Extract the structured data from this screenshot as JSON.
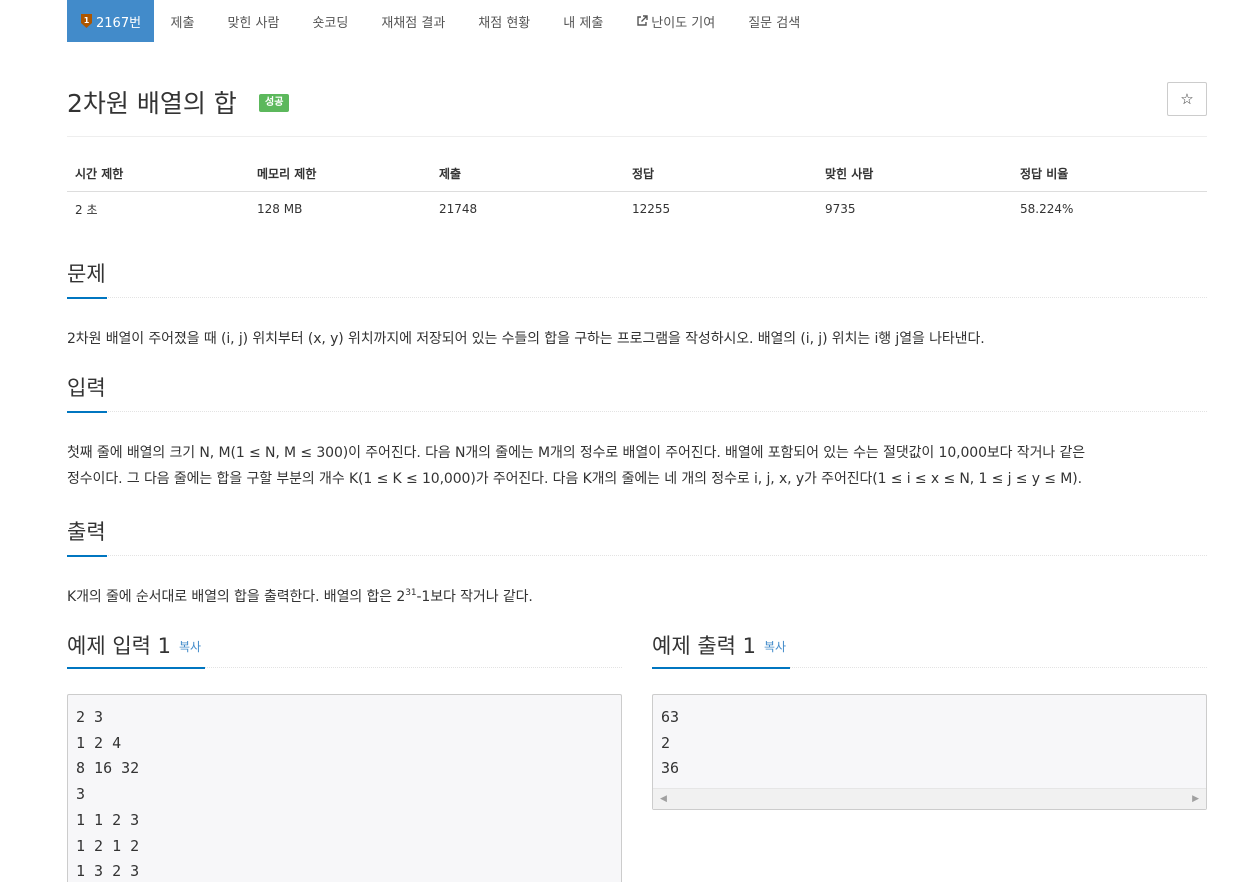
{
  "nav": {
    "tabs": [
      {
        "label": "2167번",
        "active": true
      },
      {
        "label": "제출"
      },
      {
        "label": "맞힌 사람"
      },
      {
        "label": "숏코딩"
      },
      {
        "label": "재채점 결과"
      },
      {
        "label": "채점 현황"
      },
      {
        "label": "내 제출"
      },
      {
        "label": "난이도 기여"
      },
      {
        "label": "질문 검색"
      }
    ]
  },
  "problem": {
    "title": "2차원 배열의 합",
    "status_badge": "성공",
    "star_symbol": "☆"
  },
  "info": {
    "headers": [
      "시간 제한",
      "메모리 제한",
      "제출",
      "정답",
      "맞힌 사람",
      "정답 비율"
    ],
    "values": [
      "2 초",
      "128 MB",
      "21748",
      "12255",
      "9735",
      "58.224%"
    ]
  },
  "sections": {
    "description": {
      "heading": "문제",
      "text": "2차원 배열이 주어졌을 때 (i, j) 위치부터 (x, y) 위치까지에 저장되어 있는 수들의 합을 구하는 프로그램을 작성하시오. 배열의 (i, j) 위치는 i행 j열을 나타낸다."
    },
    "input": {
      "heading": "입력",
      "line1": "첫째 줄에 배열의 크기 N, M(1 ≤ N, M ≤ 300)이 주어진다. 다음 N개의 줄에는 M개의 정수로 배열이 주어진다. 배열에 포함되어 있는 수는 절댓값이 10,000보다 작거나 같은",
      "line2": "정수이다. 그 다음 줄에는 합을 구할 부분의 개수 K(1 ≤ K ≤ 10,000)가 주어진다. 다음 K개의 줄에는 네 개의 정수로 i, j, x, y가 주어진다(1 ≤ i ≤ x ≤ N, 1 ≤ j ≤ y ≤ M)."
    },
    "output": {
      "heading": "출력",
      "text_before": "K개의 줄에 순서대로 배열의 합을 출력한다. 배열의 합은 2",
      "superscript": "31",
      "text_after": "-1보다 작거나 같다."
    }
  },
  "samples": {
    "input": {
      "heading": "예제 입력 1",
      "copy_label": "복사",
      "content": "2 3\n1 2 4\n8 16 32\n3\n1 1 2 3\n1 2 1 2\n1 3 2 3"
    },
    "output": {
      "heading": "예제 출력 1",
      "copy_label": "복사",
      "content": "63\n2\n36"
    }
  },
  "colors": {
    "primary": "#428bca",
    "success": "#5cb85c",
    "section_underline": "#0076c0",
    "tier_bronze": "#ad5600"
  },
  "icons": {
    "tier": "bronze-1-tier-icon",
    "external": "external-link-icon",
    "star": "star-outline-icon"
  }
}
